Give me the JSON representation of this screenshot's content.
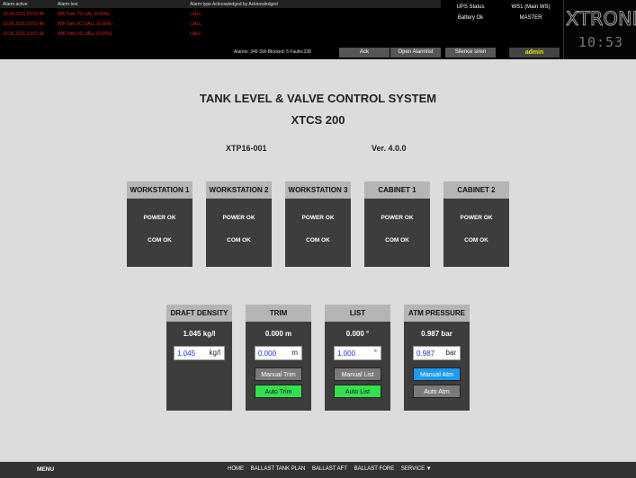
{
  "alarms": {
    "headers": {
      "active": "Alarm active",
      "text": "Alarm text",
      "type": "Alarm type Acknowledged by Acknowledged"
    },
    "rows": [
      {
        "time": "15.06.2016 10:52:48",
        "text": "WB Tank 7S LIAL (0.00%)",
        "type": "LIALL"
      },
      {
        "time": "15.06.2016 10:52:48",
        "text": "WB Tank 6C LIALL (0.00%)",
        "type": "LIALL"
      },
      {
        "time": "15.06.2016 10:52:48",
        "text": "WB Tank 5S LIALL (0.00%)",
        "type": "LIALL"
      }
    ],
    "status": "Alarms: 349    SW-Blocked: 5    Faults:338",
    "ack_label": "Ack",
    "open_label": "Open Alarmlist",
    "silence_label": "Silence siren"
  },
  "ups": {
    "title": "UPS Status",
    "status": "Battery Ok"
  },
  "ws": {
    "title": "WS1 (Main WS)",
    "role": "MASTER",
    "user": "admin"
  },
  "brand": {
    "logo": "XTRONICA",
    "time": "10:53"
  },
  "main": {
    "title": "TANK LEVEL & VALVE CONTROL SYSTEM",
    "subtitle": "XTCS 200",
    "code": "XTP16-001",
    "version": "Ver. 4.0.0"
  },
  "status_panels": [
    {
      "title": "WORKSTATION 1",
      "power": "POWER OK",
      "com": "COM OK"
    },
    {
      "title": "WORKSTATION 2",
      "power": "POWER OK",
      "com": "COM OK"
    },
    {
      "title": "WORKSTATION 3",
      "power": "POWER OK",
      "com": "COM OK"
    },
    {
      "title": "CABINET 1",
      "power": "POWER OK",
      "com": "COM OK"
    },
    {
      "title": "CABINET 2",
      "power": "POWER OK",
      "com": "COM OK"
    }
  ],
  "controls": {
    "draft": {
      "title": "DRAFT DENSITY",
      "value": "1.045 kg/l",
      "input": "1.045",
      "unit": "kg/l"
    },
    "trim": {
      "title": "TRIM",
      "value": "0.000 m",
      "input": "0.000",
      "unit": "m",
      "btn_manual": "Manual Trim",
      "btn_auto": "Auto Trim"
    },
    "list": {
      "title": "LIST",
      "value": "0.000 °",
      "input": "1.000",
      "unit": "°",
      "btn_manual": "Manual List",
      "btn_auto": "Auto List"
    },
    "atm": {
      "title": "ATM PRESSURE",
      "value": "0.987 bar",
      "input": "0.987",
      "unit": "bar",
      "btn_manual": "Manual Atm",
      "btn_auto": "Auto Atm"
    }
  },
  "colors": {
    "active_green": "#33e04d",
    "active_blue": "#1e9af0",
    "alarm_red": "#e01e1e"
  },
  "footer": {
    "menu": "MENU",
    "nav": [
      "HOME",
      "BALLAST TANK PLAN",
      "BALLAST AFT",
      "BALLAST FORE",
      "SERVICE ▼"
    ]
  }
}
